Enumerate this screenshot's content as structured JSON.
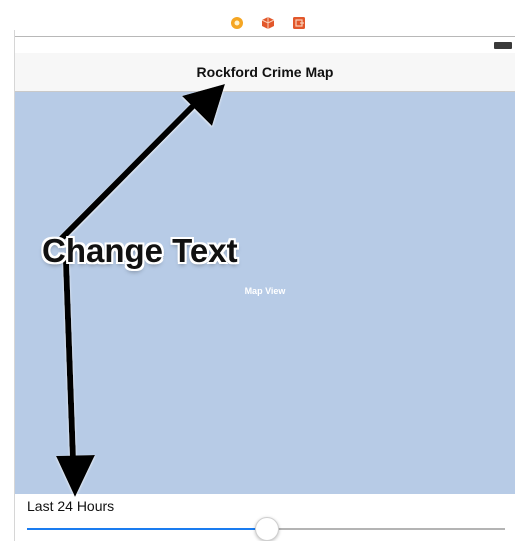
{
  "toolbar": {
    "icons": [
      "record-icon",
      "cube-icon",
      "exit-icon"
    ],
    "colors": {
      "record": "#f5a623",
      "cube": "#e2572b",
      "exit": "#e2572b"
    }
  },
  "navbar": {
    "title": "Rockford Crime Map"
  },
  "map": {
    "label": "Map View",
    "background": "#b7cbe6"
  },
  "filter": {
    "label": "Last 24 Hours",
    "slider_value_fraction": 0.5,
    "accent": "#1a7cf0"
  },
  "annotation": {
    "text": "Change Text"
  }
}
